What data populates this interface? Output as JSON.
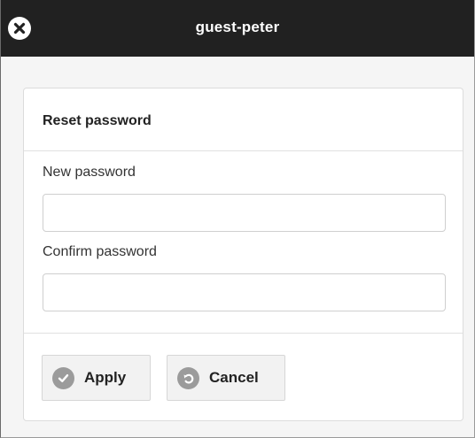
{
  "window": {
    "title": "guest-peter",
    "close_icon": "close-icon"
  },
  "panel": {
    "title": "Reset password",
    "new_password": {
      "label": "New password",
      "value": "",
      "placeholder": ""
    },
    "confirm_password": {
      "label": "Confirm password",
      "value": "",
      "placeholder": ""
    }
  },
  "actions": {
    "apply_label": "Apply",
    "apply_icon": "check-icon",
    "cancel_label": "Cancel",
    "cancel_icon": "undo-icon"
  },
  "colors": {
    "titlebar": "#212121",
    "background": "#f5f5f5",
    "panel": "#ffffff",
    "button": "#f2f2f2",
    "icon": "#9b9b9b"
  }
}
